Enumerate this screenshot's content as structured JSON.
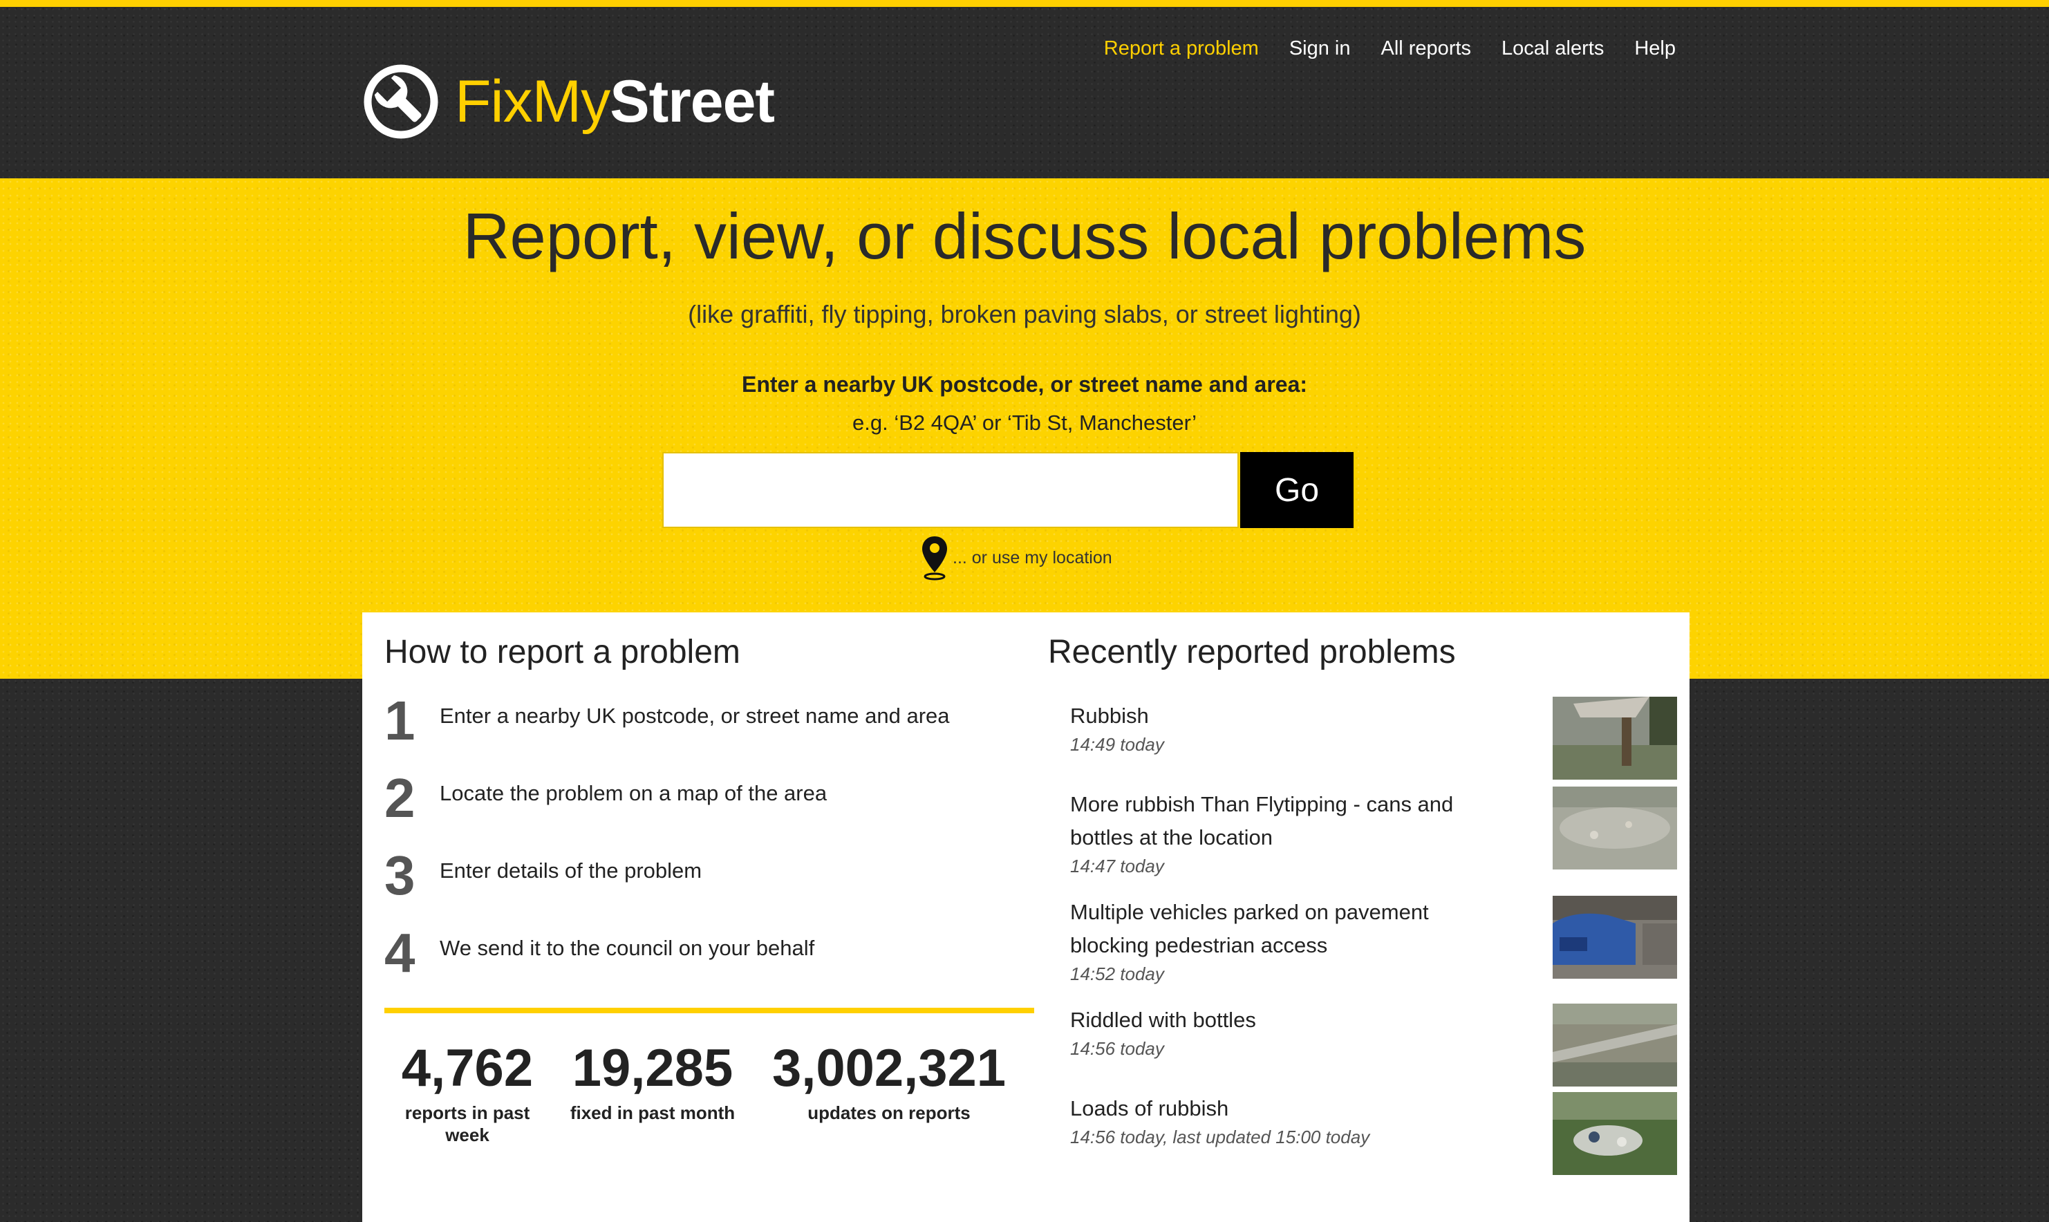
{
  "header": {
    "logo": {
      "fix": "FixMy",
      "street": "Street"
    },
    "nav": [
      "Report a problem",
      "Sign in",
      "All reports",
      "Local alerts",
      "Help"
    ]
  },
  "hero": {
    "title": "Report, view, or discuss local problems",
    "subtitle": "(like graffiti, fly tipping, broken paving slabs, or street lighting)",
    "postcode_label": "Enter a nearby UK postcode, or street name and area:",
    "example": "e.g. ‘B2 4QA’ or ‘Tib St, Manchester’",
    "input_value": "",
    "go_label": "Go",
    "geolocate_label": "... or use my location"
  },
  "how_to": {
    "title": "How to report a problem",
    "steps": [
      {
        "num": "1",
        "text": "Enter a nearby UK postcode, or street name and area"
      },
      {
        "num": "2",
        "text": "Locate the problem on a map of the area"
      },
      {
        "num": "3",
        "text": "Enter details of the problem"
      },
      {
        "num": "4",
        "text": "We send it to the council on your behalf"
      }
    ]
  },
  "stats": [
    {
      "num": "4,762",
      "label": "reports in past week"
    },
    {
      "num": "19,285",
      "label": "fixed in past month"
    },
    {
      "num": "3,002,321",
      "label": "updates on reports"
    }
  ],
  "recent": {
    "title": "Recently reported problems",
    "items": [
      {
        "title": "Rubbish",
        "time": "14:49 today"
      },
      {
        "title": "More rubbish Than Flytipping - cans and bottles at the location",
        "time": "14:47 today"
      },
      {
        "title": "Multiple vehicles parked on pavement blocking pedestrian access",
        "time": "14:52 today"
      },
      {
        "title": "Riddled with bottles",
        "time": "14:56 today"
      },
      {
        "title": "Loads of rubbish",
        "time": "14:56 today, last updated 15:00 today"
      }
    ]
  },
  "colors": {
    "brand_yellow": "#ffd000",
    "dark": "#2b2b2b",
    "text": "#222222"
  }
}
